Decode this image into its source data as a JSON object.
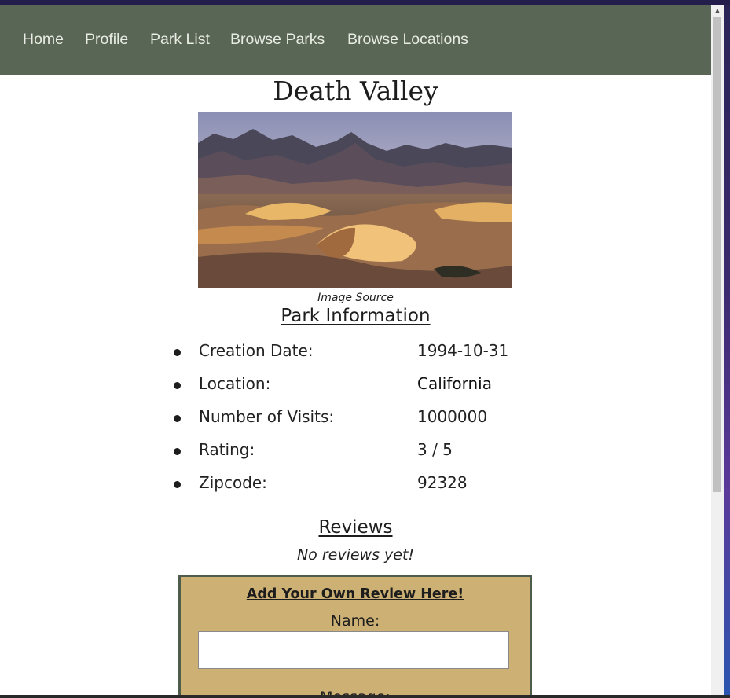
{
  "nav": {
    "links": [
      "Home",
      "Profile",
      "Park List",
      "Browse Parks",
      "Browse Locations"
    ]
  },
  "park": {
    "name": "Death Valley",
    "image_caption": "Image Source"
  },
  "info": {
    "heading": "Park Information",
    "rows": [
      {
        "label": "Creation Date:",
        "value": "1994-10-31"
      },
      {
        "label": "Location:",
        "value": "California"
      },
      {
        "label": "Number of Visits:",
        "value": "1000000"
      },
      {
        "label": "Rating:",
        "value": "3 / 5"
      },
      {
        "label": "Zipcode:",
        "value": "92328"
      }
    ]
  },
  "reviews": {
    "heading": "Reviews",
    "empty_text": "No reviews yet!"
  },
  "review_form": {
    "title": "Add Your Own Review Here!",
    "name_label": "Name:",
    "name_value": "",
    "message_label": "Message:"
  },
  "colors": {
    "nav_bg": "#5a6655",
    "form_bg": "#cdb074",
    "form_border": "#4f5b4b"
  }
}
